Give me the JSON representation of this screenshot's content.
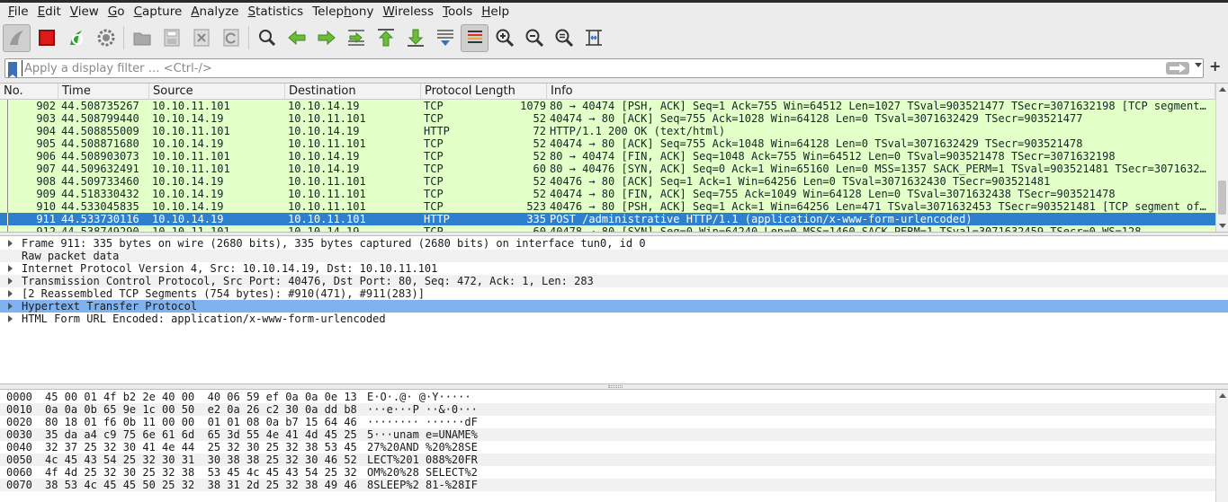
{
  "menu": [
    "File",
    "Edit",
    "View",
    "Go",
    "Capture",
    "Analyze",
    "Statistics",
    "Telephony",
    "Wireless",
    "Tools",
    "Help"
  ],
  "menu_underline": [
    "F",
    "E",
    "V",
    "G",
    "C",
    "A",
    "S",
    "h",
    "W",
    "T",
    "H"
  ],
  "toolbar": {
    "buttons": [
      "shark-fin-start-icon",
      "stop-capture-icon",
      "restart-capture-icon",
      "capture-options-icon",
      "open-file-icon",
      "save-file-icon",
      "close-file-icon",
      "reload-file-icon",
      "find-packet-icon",
      "go-back-icon",
      "go-forward-icon",
      "go-to-packet-icon",
      "go-first-icon",
      "go-last-icon",
      "autoscroll-icon",
      "colorize-icon",
      "zoom-in-icon",
      "zoom-out-icon",
      "normal-size-icon",
      "resize-columns-icon"
    ]
  },
  "filter": {
    "placeholder": "Apply a display filter … <Ctrl-/>",
    "add_label": "+"
  },
  "packet_list": {
    "columns": [
      "No.",
      "Time",
      "Source",
      "Destination",
      "Protocol",
      "Length",
      "Info"
    ],
    "rows": [
      {
        "no": "902",
        "time": "44.508735267",
        "src": "10.10.11.101",
        "dst": "10.10.14.19",
        "proto": "TCP",
        "len": "1079",
        "info": "80 → 40474 [PSH, ACK] Seq=1 Ack=755 Win=64512 Len=1027 TSval=903521477 TSecr=3071632198 [TCP segment …"
      },
      {
        "no": "903",
        "time": "44.508799440",
        "src": "10.10.14.19",
        "dst": "10.10.11.101",
        "proto": "TCP",
        "len": "52",
        "info": "40474 → 80 [ACK] Seq=755 Ack=1028 Win=64128 Len=0 TSval=3071632429 TSecr=903521477"
      },
      {
        "no": "904",
        "time": "44.508855009",
        "src": "10.10.11.101",
        "dst": "10.10.14.19",
        "proto": "HTTP",
        "len": "72",
        "info": "HTTP/1.1 200 OK  (text/html)"
      },
      {
        "no": "905",
        "time": "44.508871680",
        "src": "10.10.14.19",
        "dst": "10.10.11.101",
        "proto": "TCP",
        "len": "52",
        "info": "40474 → 80 [ACK] Seq=755 Ack=1048 Win=64128 Len=0 TSval=3071632429 TSecr=903521478"
      },
      {
        "no": "906",
        "time": "44.508903073",
        "src": "10.10.11.101",
        "dst": "10.10.14.19",
        "proto": "TCP",
        "len": "52",
        "info": "80 → 40474 [FIN, ACK] Seq=1048 Ack=755 Win=64512 Len=0 TSval=903521478 TSecr=3071632198"
      },
      {
        "no": "907",
        "time": "44.509632491",
        "src": "10.10.11.101",
        "dst": "10.10.14.19",
        "proto": "TCP",
        "len": "60",
        "info": "80 → 40476 [SYN, ACK] Seq=0 Ack=1 Win=65160 Len=0 MSS=1357 SACK_PERM=1 TSval=903521481 TSecr=30716322…"
      },
      {
        "no": "908",
        "time": "44.509733460",
        "src": "10.10.14.19",
        "dst": "10.10.11.101",
        "proto": "TCP",
        "len": "52",
        "info": "40476 → 80 [ACK] Seq=1 Ack=1 Win=64256 Len=0 TSval=3071632430 TSecr=903521481"
      },
      {
        "no": "909",
        "time": "44.518330432",
        "src": "10.10.14.19",
        "dst": "10.10.11.101",
        "proto": "TCP",
        "len": "52",
        "info": "40474 → 80 [FIN, ACK] Seq=755 Ack=1049 Win=64128 Len=0 TSval=3071632438 TSecr=903521478"
      },
      {
        "no": "910",
        "time": "44.533045835",
        "src": "10.10.14.19",
        "dst": "10.10.11.101",
        "proto": "TCP",
        "len": "523",
        "info": "40476 → 80 [PSH, ACK] Seq=1 Ack=1 Win=64256 Len=471 TSval=3071632453 TSecr=903521481 [TCP segment of …"
      },
      {
        "no": "911",
        "time": "44.533730116",
        "src": "10.10.14.19",
        "dst": "10.10.11.101",
        "proto": "HTTP",
        "len": "335",
        "info": "POST /administrative HTTP/1.1  (application/x-www-form-urlencoded)"
      },
      {
        "no": "912",
        "time": "44.538749290",
        "src": "10.10.11.101",
        "dst": "10.10.14.19",
        "proto": "TCP",
        "len": "60",
        "info": "40478 → 80 [SYN] Seq=0 Win=64240 Len=0 MSS=1460 SACK_PERM=1 TSval=3071632459 TSecr=0 WS=128"
      }
    ],
    "selected_no": "911"
  },
  "details": [
    "Frame 911: 335 bytes on wire (2680 bits), 335 bytes captured (2680 bits) on interface tun0, id 0",
    "Raw packet data",
    "Internet Protocol Version 4, Src: 10.10.14.19, Dst: 10.10.11.101",
    "Transmission Control Protocol, Src Port: 40476, Dst Port: 80, Seq: 472, Ack: 1, Len: 283",
    "[2 Reassembled TCP Segments (754 bytes): #910(471), #911(283)]",
    "Hypertext Transfer Protocol",
    "HTML Form URL Encoded: application/x-www-form-urlencoded"
  ],
  "bytes": [
    {
      "off": "0000",
      "hex": "45 00 01 4f b2 2e 40 00  40 06 59 ef 0a 0a 0e 13",
      "ascii": "E·O·.@· @·Y·····"
    },
    {
      "off": "0010",
      "hex": "0a 0a 0b 65 9e 1c 00 50  e2 0a 26 c2 30 0a dd b8",
      "ascii": "···e···P ··&·0···"
    },
    {
      "off": "0020",
      "hex": "80 18 01 f6 0b 11 00 00  01 01 08 0a b7 15 64 46",
      "ascii": "········ ······dF"
    },
    {
      "off": "0030",
      "hex": "35 da a4 c9 75 6e 61 6d  65 3d 55 4e 41 4d 45 25",
      "ascii": "5···unam e=UNAME%"
    },
    {
      "off": "0040",
      "hex": "32 37 25 32 30 41 4e 44  25 32 30 25 32 38 53 45",
      "ascii": "27%20AND %20%28SE"
    },
    {
      "off": "0050",
      "hex": "4c 45 43 54 25 32 30 31  30 38 38 25 32 30 46 52",
      "ascii": "LECT%201 088%20FR"
    },
    {
      "off": "0060",
      "hex": "4f 4d 25 32 30 25 32 38  53 45 4c 45 43 54 25 32",
      "ascii": "OM%20%28 SELECT%2"
    },
    {
      "off": "0070",
      "hex": "38 53 4c 45 45 50 25 32  38 31 2d 25 32 38 49 46",
      "ascii": "8SLEEP%2 81-%28IF"
    }
  ],
  "colors": {
    "tcp_row": "#e4ffc7",
    "selected_row": "#2f7fcf",
    "highlight_detail": "#7fb3f0"
  }
}
